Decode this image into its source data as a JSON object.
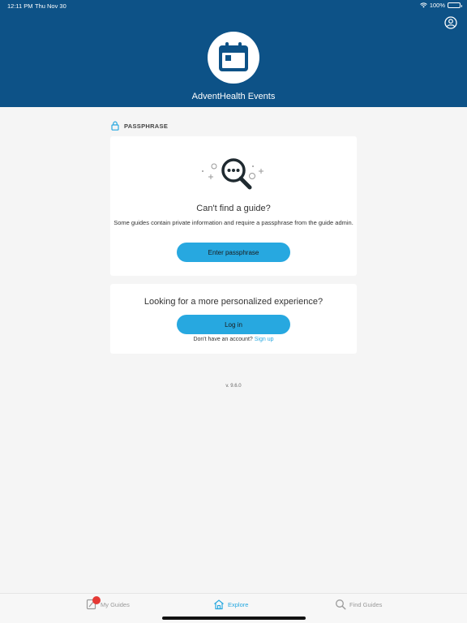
{
  "status_bar": {
    "time": "12:11 PM",
    "date": "Thu Nov 30",
    "battery": "100%"
  },
  "header": {
    "title": "AdventHealth Events",
    "logo_icon": "calendar-icon",
    "profile_icon": "user-circle-icon"
  },
  "section": {
    "label": "PASSPHRASE",
    "icon": "lock-icon"
  },
  "passphrase_card": {
    "title": "Can't find a guide?",
    "description": "Some guides contain private information and require a passphrase from the guide admin.",
    "button": "Enter passphrase",
    "illustration_icon": "search-icon"
  },
  "login_card": {
    "title": "Looking for a more personalized experience?",
    "button": "Log in",
    "prompt": "Don't have an account?",
    "link": "Sign up"
  },
  "version": "v. 9.6.0",
  "tabs": [
    {
      "label": "My Guides",
      "icon": "guide-book-icon"
    },
    {
      "label": "Explore",
      "icon": "home-icon"
    },
    {
      "label": "Find Guides",
      "icon": "search-icon"
    }
  ],
  "colors": {
    "header": "#0d5287",
    "accent": "#27a8e0",
    "background": "#f5f5f5",
    "badge": "#e53935"
  }
}
